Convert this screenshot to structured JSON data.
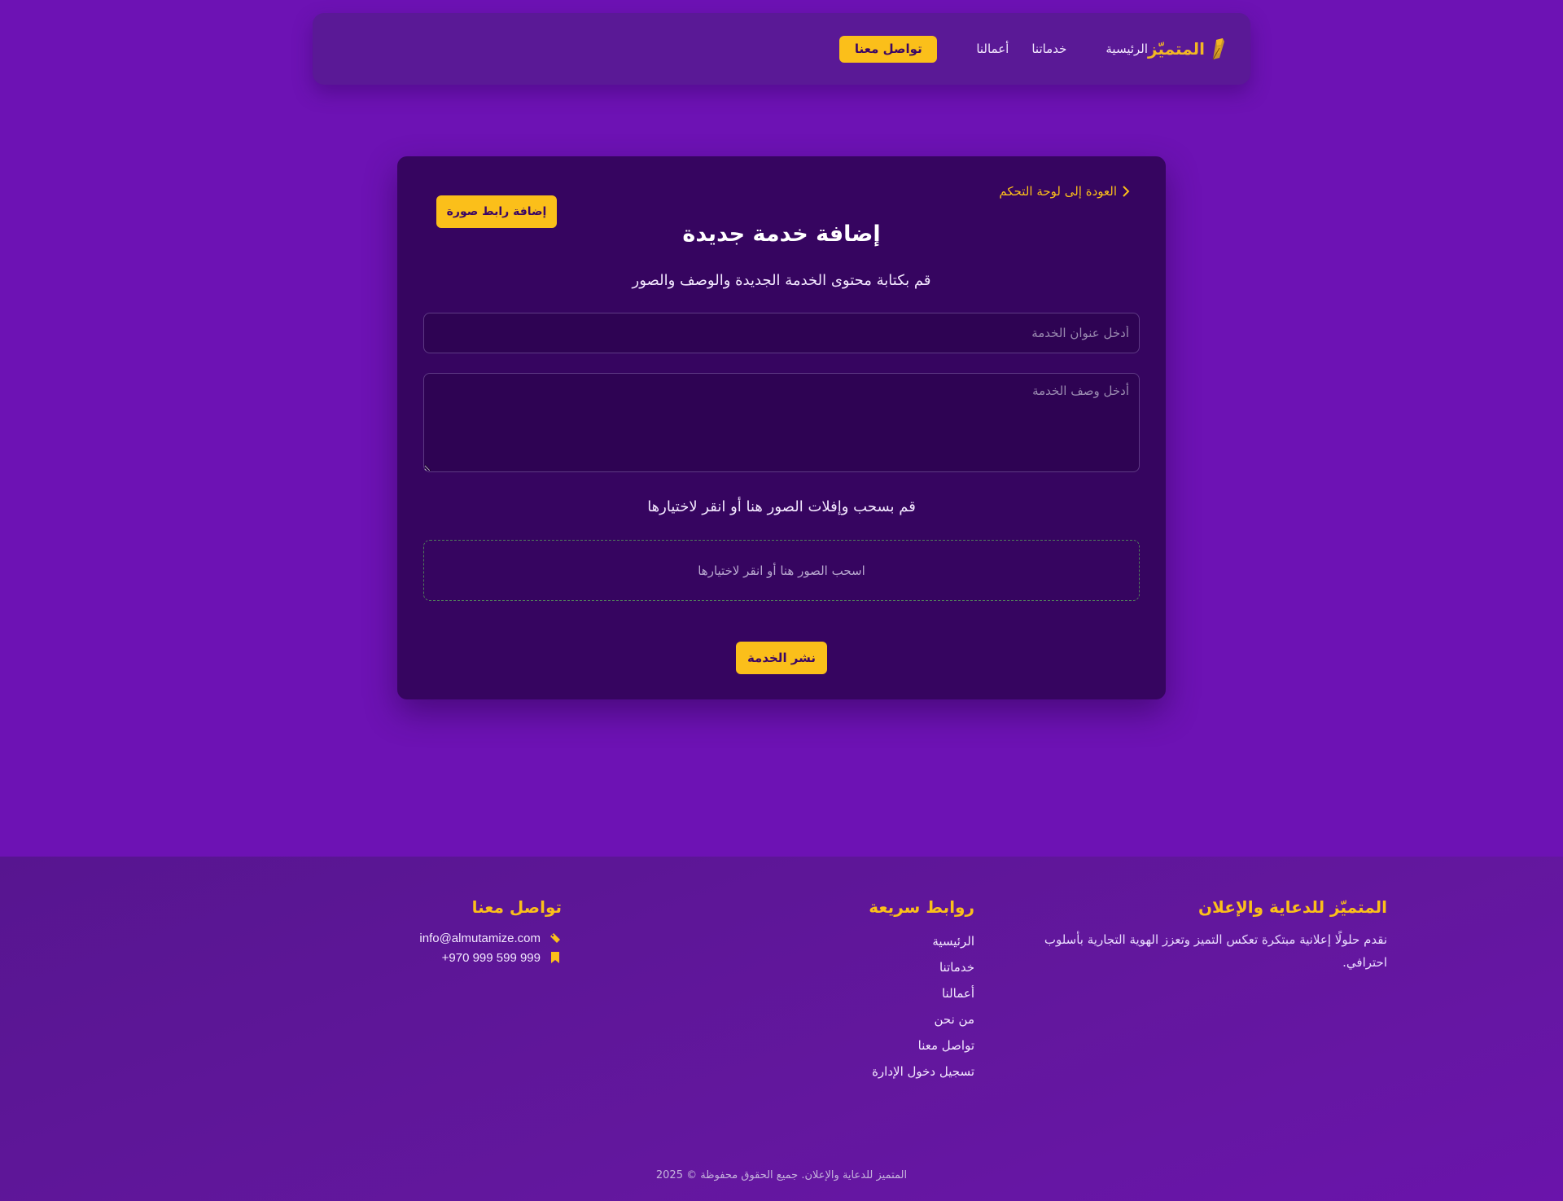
{
  "nav": {
    "brand": "المتميّز",
    "brand_icon": "quill-pen-icon",
    "links": [
      "الرئيسية",
      "خدماتنا",
      "أعمالنا"
    ],
    "contact_button": "تواصل معنا"
  },
  "form": {
    "back_link": "العودة إلى لوحة التحكم",
    "add_image_link_button": "إضافة رابط صورة",
    "title": "إضافة خدمة جديدة",
    "subtitle": "قم بكتابة محتوى الخدمة الجديدة والوصف والصور",
    "title_placeholder": "أدخل عنوان الخدمة",
    "title_value": "",
    "description_placeholder": "أدخل وصف الخدمة",
    "description_value": "",
    "drop_heading": "قم بسحب وإفلات الصور هنا أو انقر لاختيارها",
    "drop_zone_text": "اسحب الصور هنا أو انقر لاختيارها",
    "publish_button": "نشر الخدمة"
  },
  "footer": {
    "about_title": "المتميّز للدعاية والإعلان",
    "about_text": "نقدم حلولًا إعلانية مبتكرة تعكس التميز وتعزز الهوية التجارية بأسلوب احترافي.",
    "links_title": "روابط سريعة",
    "links": [
      "الرئيسية",
      "خدماتنا",
      "أعمالنا",
      "من نحن",
      "تواصل معنا",
      "تسجيل دخول الإدارة"
    ],
    "contact_title": "تواصل معنا",
    "email": "info@almutamize.com",
    "phone": "+970 999 599 999",
    "copyright": "المتميز للدعاية والإعلان. جميع الحقوق محفوظة © 2025"
  },
  "colors": {
    "background": "#6d12b4",
    "navbar": "#5a1996",
    "card": "#360560",
    "accent": "#fbbf1a"
  }
}
